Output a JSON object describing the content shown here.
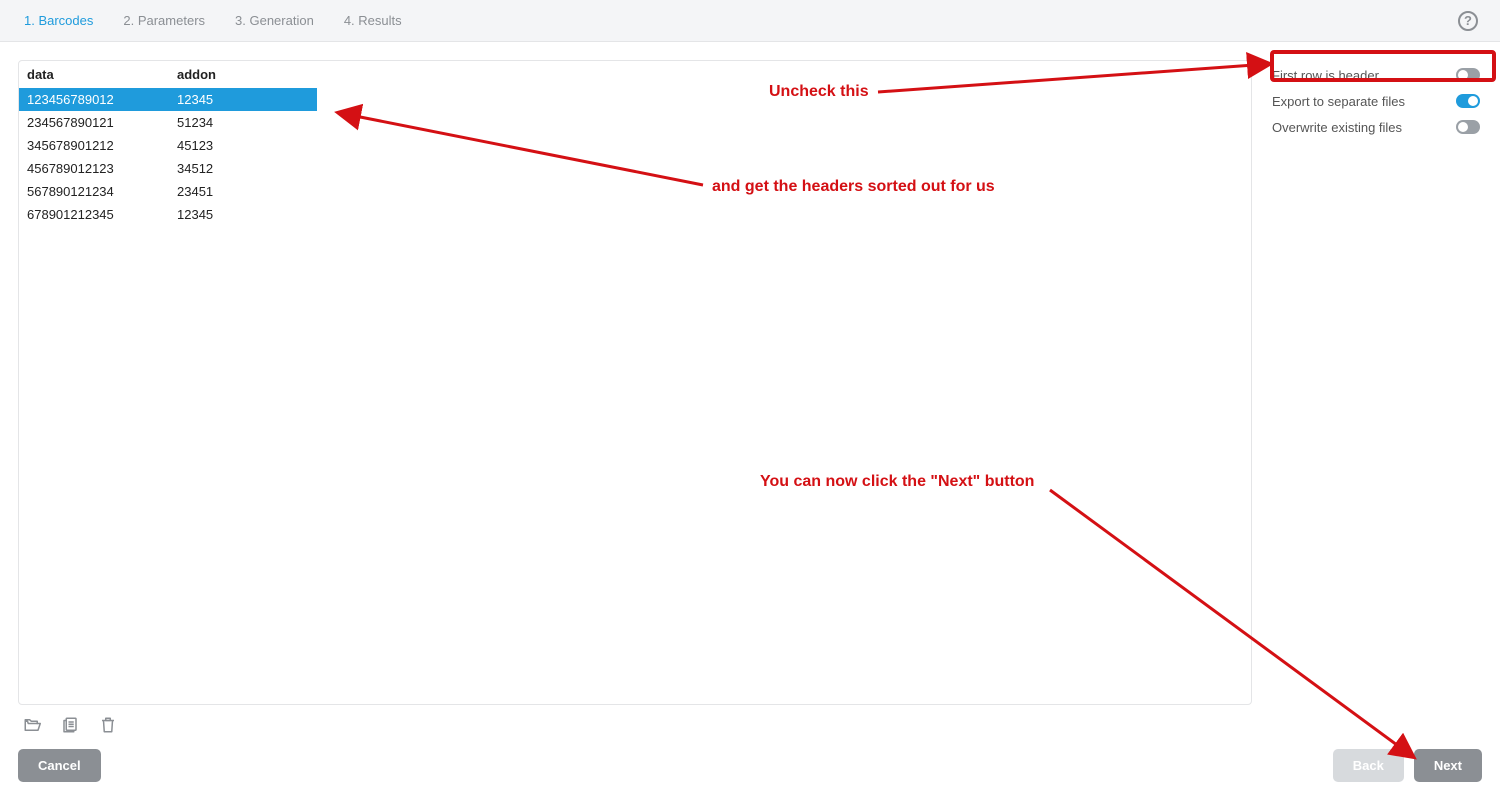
{
  "header": {
    "tabs": [
      {
        "label": "1. Barcodes",
        "active": true
      },
      {
        "label": "2. Parameters",
        "active": false
      },
      {
        "label": "3. Generation",
        "active": false
      },
      {
        "label": "4. Results",
        "active": false
      }
    ]
  },
  "table": {
    "headers": {
      "data": "data",
      "addon": "addon"
    },
    "rows": [
      {
        "data": "123456789012",
        "addon": "12345",
        "selected": true
      },
      {
        "data": "234567890121",
        "addon": "51234",
        "selected": false
      },
      {
        "data": "345678901212",
        "addon": "45123",
        "selected": false
      },
      {
        "data": "456789012123",
        "addon": "34512",
        "selected": false
      },
      {
        "data": "567890121234",
        "addon": "23451",
        "selected": false
      },
      {
        "data": "678901212345",
        "addon": "12345",
        "selected": false
      }
    ]
  },
  "options": [
    {
      "label": "First row is header",
      "on": false,
      "key": "first_row_header"
    },
    {
      "label": "Export to separate files",
      "on": true,
      "key": "export_separate"
    },
    {
      "label": "Overwrite existing files",
      "on": false,
      "key": "overwrite"
    }
  ],
  "footer": {
    "cancel": "Cancel",
    "back": "Back",
    "next": "Next"
  },
  "annotations": {
    "uncheck": "Uncheck this",
    "headers_sorted": "and get the headers sorted out for us",
    "click_next": "You can now click the \"Next\" button"
  }
}
